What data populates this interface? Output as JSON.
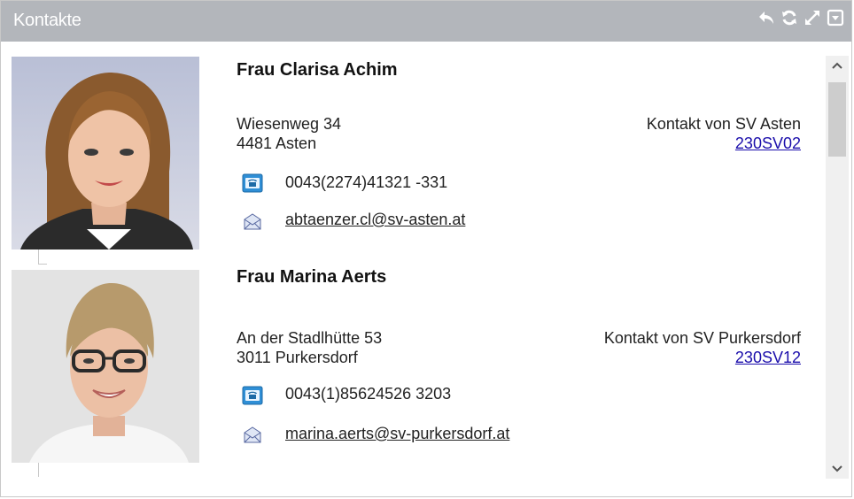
{
  "window": {
    "title": "Kontakte",
    "icons": [
      "back-icon",
      "refresh-icon",
      "expand-icon",
      "collapse-icon"
    ]
  },
  "contacts": [
    {
      "name": "Frau Clarisa Achim",
      "street": "Wiesenweg 34",
      "city": "4481 Asten",
      "contact_of": "Kontakt von SV Asten",
      "contact_code": "230SV02",
      "phone": "0043(2274)41321 -331",
      "email": "abtaenzer.cl@sv-asten.at"
    },
    {
      "name": "Frau Marina Aerts",
      "street": "An der Stadlhütte 53",
      "city": "3011 Purkersdorf",
      "contact_of": "Kontakt von SV Purkersdorf",
      "contact_code": "230SV12",
      "phone": "0043(1)85624526 3203",
      "email": "marina.aerts@sv-purkersdorf.at"
    }
  ],
  "colors": {
    "titlebar": "#b3b6bb",
    "link": "#1a0dab",
    "phone_icon": "#2f8fd6"
  }
}
